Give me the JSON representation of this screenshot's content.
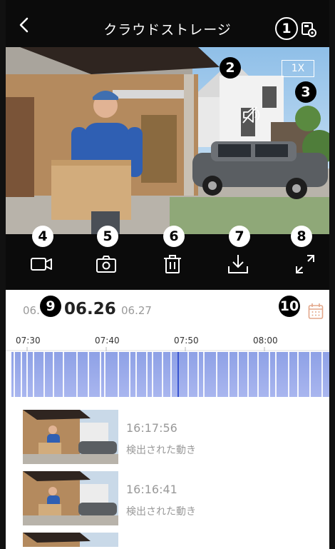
{
  "header": {
    "title": "クラウドストレージ"
  },
  "badges": {
    "b1": "1",
    "b2": "2",
    "b3": "3",
    "b4": "4",
    "b5": "5",
    "b6": "6",
    "b7": "7",
    "b8": "8",
    "b9": "9",
    "b10": "10"
  },
  "video": {
    "zoom_label": "1X"
  },
  "dates": {
    "prev": "06.",
    "current": "06.26",
    "next": "06.27"
  },
  "timeline": {
    "labels": [
      "07:30",
      "07:40",
      "07:50",
      "08:00"
    ]
  },
  "recordings": [
    {
      "time": "16:17:56",
      "label": "検出された動き"
    },
    {
      "time": "16:16:41",
      "label": "検出された動き"
    }
  ],
  "colors": {
    "timeline": "#95a6ea",
    "marker": "#3a55d0",
    "bar": "#0b0b0b"
  },
  "icons": [
    "back-arrow-icon",
    "settings-icon",
    "mute-icon",
    "record-icon",
    "camera-icon",
    "trash-icon",
    "download-icon",
    "fullscreen-icon",
    "calendar-icon"
  ]
}
